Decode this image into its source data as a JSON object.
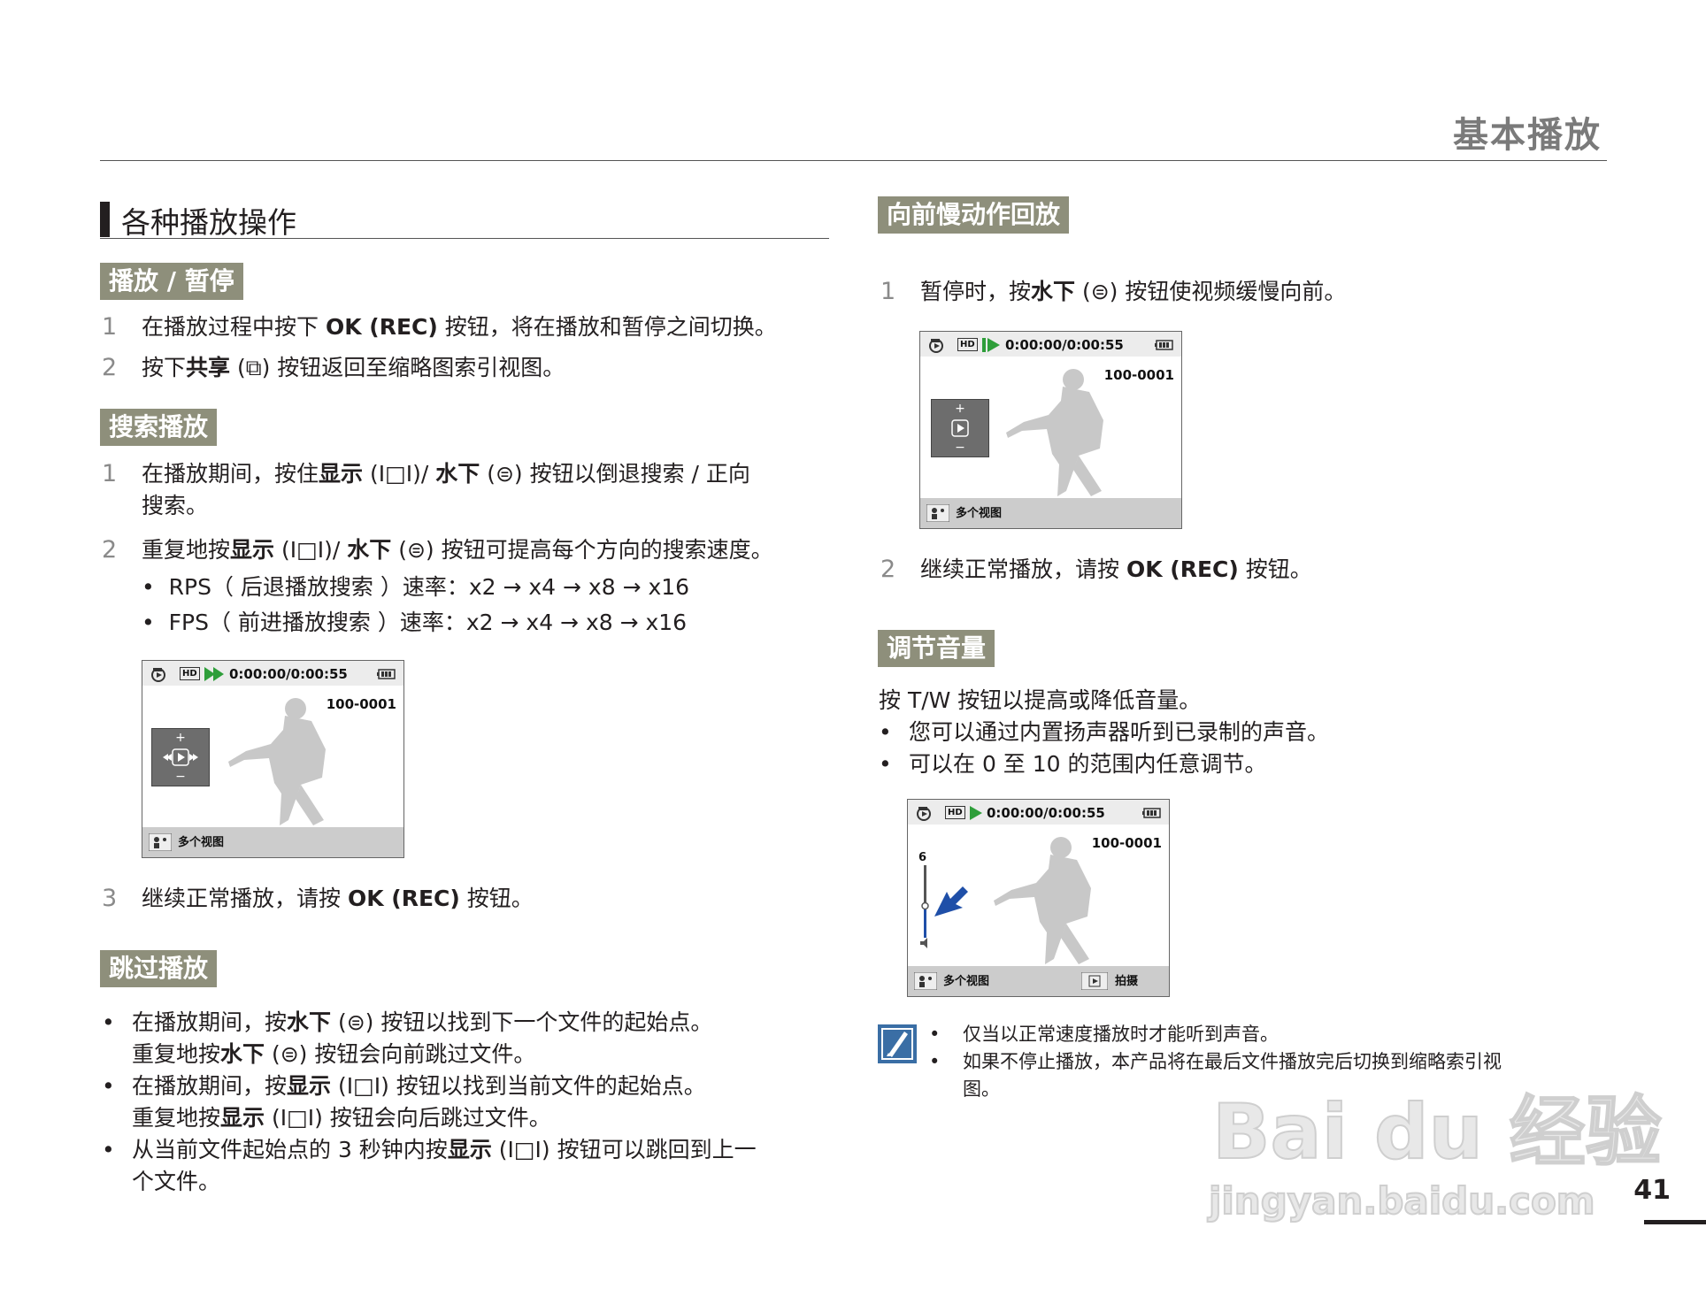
{
  "header": {
    "title": "基本播放"
  },
  "section": {
    "title": "各种播放操作"
  },
  "left": {
    "play_pause": {
      "heading": "播放 / 暂停",
      "items": [
        {
          "num": "1",
          "pre": "在播放过程中按下 ",
          "bold": "OK (REC)",
          "post": " 按钮，将在播放和暂停之间切换。"
        },
        {
          "num": "2",
          "pre": "按下",
          "bold": "共享",
          "post": " (⧉) 按钮返回至缩略图索引视图。"
        }
      ]
    },
    "search": {
      "heading": "搜索播放",
      "item1": {
        "num": "1",
        "pre": "在播放期间，按住",
        "bold1": "显示",
        "mid1": " (I□I)/ ",
        "bold2": "水下",
        "mid2": " (⊜) 按钮以倒退搜索 / 正向",
        "line2": "搜索。"
      },
      "item2": {
        "num": "2",
        "pre": "重复地按",
        "bold1": "显示",
        "mid1": " (I□I)/ ",
        "bold2": "水下",
        "mid2": " (⊜) 按钮可提高每个方向的搜索速度。"
      },
      "bullets": [
        "RPS（ 后退播放搜索 ）速率：x2 → x4 → x8 → x16",
        "FPS（ 前进播放搜索 ）速率：x2 → x4 → x8 → x16"
      ],
      "item3": {
        "num": "3",
        "pre": "继续正常播放，请按 ",
        "bold": "OK (REC)",
        "post": " 按钮。"
      }
    },
    "skip": {
      "heading": "跳过播放",
      "bullets": [
        {
          "l1pre": "在播放期间，按",
          "l1bold": "水下",
          "l1post": " (⊜) 按钮以找到下一个文件的起始点。",
          "l2pre": "重复地按",
          "l2bold": "水下",
          "l2post": " (⊜) 按钮会向前跳过文件。"
        },
        {
          "l1pre": "在播放期间，按",
          "l1bold": "显示",
          "l1post": " (I□I) 按钮以找到当前文件的起始点。",
          "l2pre": "重复地按",
          "l2bold": "显示",
          "l2post": " (I□I) 按钮会向后跳过文件。"
        },
        {
          "l1pre": "从当前文件起始点的 3 秒钟内按",
          "l1bold": "显示",
          "l1post": " (I□I) 按钮可以跳回到上一",
          "l2pre": "个文件。",
          "l2bold": "",
          "l2post": ""
        }
      ]
    }
  },
  "right": {
    "slow": {
      "heading": "向前慢动作回放",
      "item1": {
        "num": "1",
        "pre": "暂停时，按",
        "bold": "水下",
        "post": " (⊜) 按钮使视频缓慢向前。"
      },
      "item2": {
        "num": "2",
        "pre": "继续正常播放，请按 ",
        "bold": "OK (REC)",
        "post": " 按钮。"
      }
    },
    "volume": {
      "heading": "调节音量",
      "intro": "按  T/W  按钮以提高或降低音量。",
      "bullets": [
        "您可以通过内置扬声器听到已录制的声音。",
        "可以在 0 至 10 的范围内任意调节。"
      ]
    },
    "note": {
      "bullets": [
        "仅当以正常速度播放时才能听到声音。",
        "如果不停止播放，本产品将在最后文件播放完后切换到缩略索引视",
        "图。"
      ]
    }
  },
  "screen": {
    "hd": "HD",
    "time": "0:00:00/0:00:55",
    "file": "100-0001",
    "multiview": "多个视图",
    "shoot": "拍摄",
    "volume_level": "6"
  },
  "watermark": {
    "brand": "Bai du 经验",
    "url": "jingyan.baidu.com"
  },
  "page_number": "41",
  "colors": {
    "subheading_bg": "#8e8f7b",
    "play_green": "#2e9e3a",
    "arrow_blue": "#1f4fa8",
    "note_icon": "#3a6ea5"
  }
}
